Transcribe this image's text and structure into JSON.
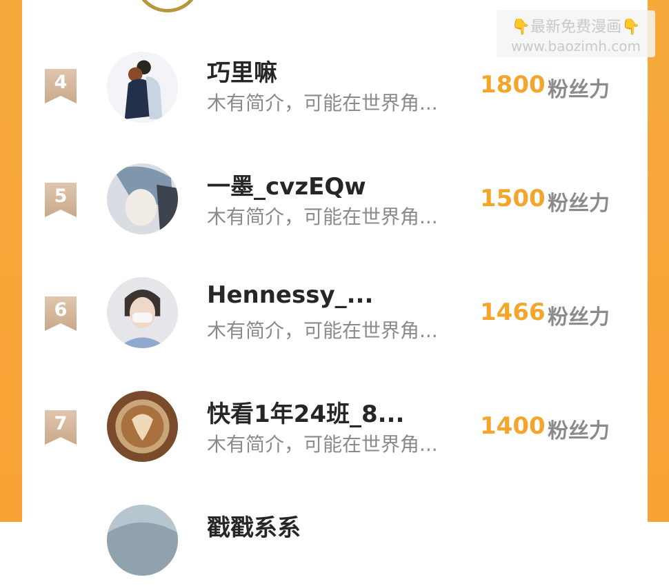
{
  "watermark": {
    "line1": "最新免费漫画",
    "line2": "www.baozimh.com",
    "hand_icon": "👇"
  },
  "entries": [
    {
      "rank": "4",
      "name": "巧里嘛",
      "desc": "木有简介，可能在世界角...",
      "score": "1800",
      "unit": "粉丝力"
    },
    {
      "rank": "5",
      "name": "一墨_cvzEQw",
      "desc": "木有简介，可能在世界角...",
      "score": "1500",
      "unit": "粉丝力"
    },
    {
      "rank": "6",
      "name": "Hennessy_...",
      "desc": "木有简介，可能在世界角...",
      "score": "1466",
      "unit": "粉丝力"
    },
    {
      "rank": "7",
      "name": "快看1年24班_8...",
      "desc": "木有简介，可能在世界角...",
      "score": "1400",
      "unit": "粉丝力"
    },
    {
      "rank": "",
      "name": "戳戳系系",
      "desc": "",
      "score": "",
      "unit": ""
    }
  ],
  "colors": {
    "frame": "#f7a93b",
    "score": "#f3a52c",
    "rank_badge": "#d4b597"
  }
}
